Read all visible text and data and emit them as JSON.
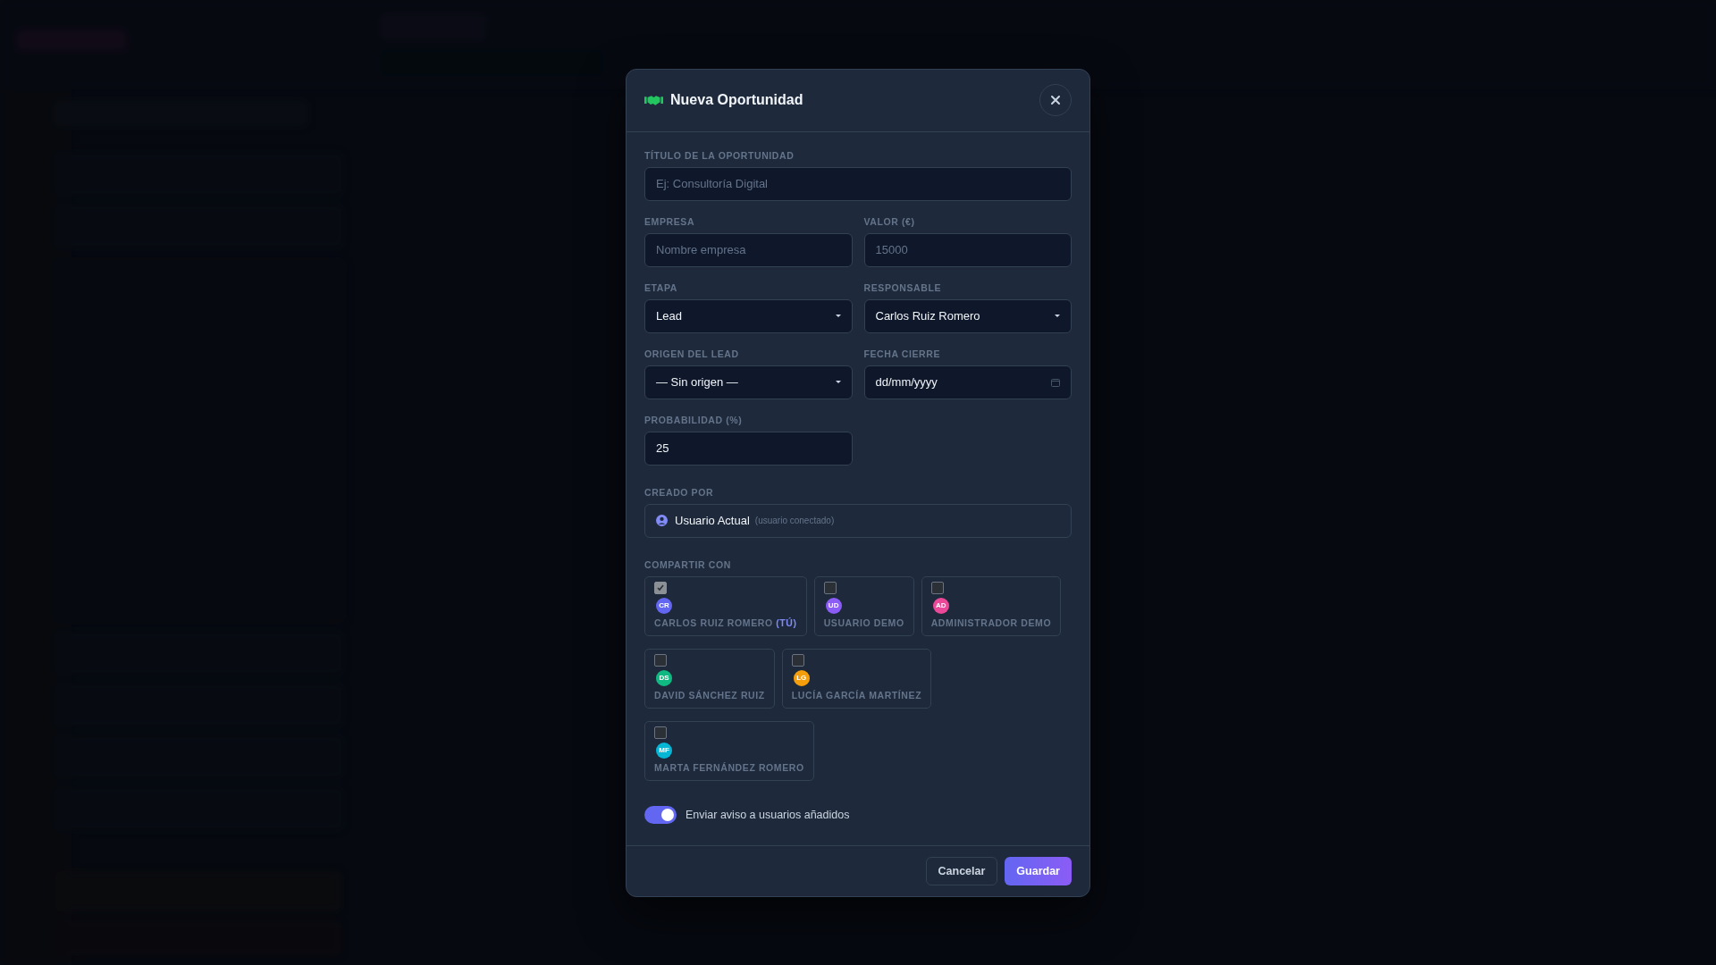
{
  "modal": {
    "title": "Nueva Oportunidad",
    "fields": [
      {
        "kind": "input",
        "label": "TÍTULO DE LA OPORTUNIDAD",
        "placeholder": "Ej: Consultoría Digital"
      },
      {
        "kind": "input",
        "label": "EMPRESA",
        "placeholder": "Nombre empresa"
      },
      {
        "kind": "input",
        "label": "VALOR (€)",
        "placeholder": "15000"
      },
      {
        "kind": "select",
        "label": "ETAPA",
        "value": "Lead"
      },
      {
        "kind": "select",
        "label": "RESPONSABLE",
        "value": "Carlos Ruiz Romero"
      },
      {
        "kind": "select",
        "label": "ORIGEN DEL LEAD",
        "value": "— Sin origen —"
      },
      {
        "kind": "date",
        "label": "FECHA CIERRE",
        "value": "dd/mm/yyyy"
      },
      {
        "kind": "input",
        "label": "PROBABILIDAD (%)",
        "value": "25"
      }
    ],
    "created_by": {
      "label": "CREADO POR",
      "name": "Usuario Actual",
      "note": "(usuario conectado)"
    },
    "share": {
      "label": "COMPARTIR CON",
      "users": [
        {
          "initials": "CR",
          "name": "CARLOS RUIZ ROMERO",
          "tag": "(TÚ)",
          "checked": true,
          "color": "#6366f1"
        },
        {
          "initials": "UD",
          "name": "USUARIO DEMO",
          "checked": false,
          "color": "#8b5cf6"
        },
        {
          "initials": "AD",
          "name": "ADMINISTRADOR DEMO",
          "checked": false,
          "color": "#ec4899"
        },
        {
          "initials": "DS",
          "name": "DAVID SÁNCHEZ RUIZ",
          "checked": false,
          "color": "#10b981"
        },
        {
          "initials": "LG",
          "name": "LUCÍA GARCÍA MARTÍNEZ",
          "checked": false,
          "color": "#f59e0b"
        },
        {
          "initials": "MF",
          "name": "MARTA FERNÁNDEZ ROMERO",
          "checked": false,
          "color": "#06b6d4"
        }
      ]
    },
    "notify": {
      "label": "Enviar aviso a usuarios añadidos",
      "on": true
    },
    "buttons": [
      {
        "kind": "secondary",
        "label": "Cancelar"
      },
      {
        "kind": "primary",
        "label": "Guardar"
      }
    ]
  }
}
